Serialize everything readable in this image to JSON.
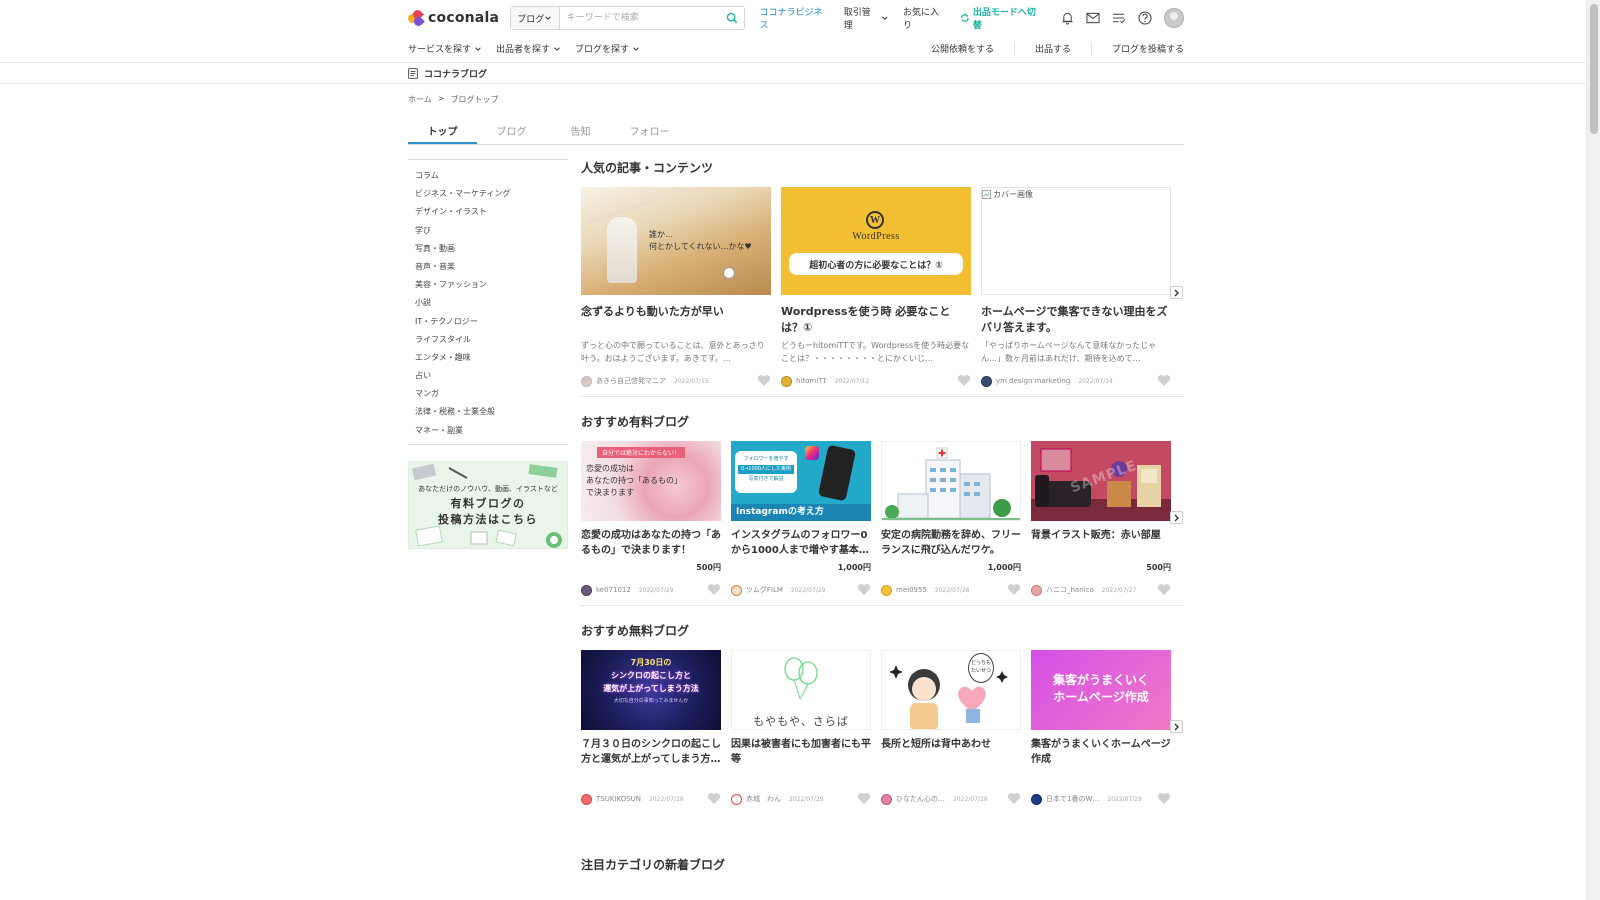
{
  "header": {
    "logo_text": "coconala",
    "search": {
      "category": "ブログ",
      "placeholder": "キーワードで検索"
    },
    "nav": {
      "business": "ココナラビジネス",
      "trade": "取引管理",
      "favorites": "お気に入り",
      "seller_mode": "出品モードへ切替"
    }
  },
  "subnav": {
    "left": [
      "サービスを探す",
      "出品者を探す",
      "ブログを探す"
    ],
    "right": [
      "公開依頼をする",
      "出品する",
      "ブログを投稿する"
    ]
  },
  "band": {
    "title": "ココナラブログ"
  },
  "breadcrumb": [
    "ホーム",
    ">",
    "ブログトップ"
  ],
  "tabs": [
    "トップ",
    "ブログ",
    "告知",
    "フォロー"
  ],
  "sidebar": {
    "categories": [
      "コラム",
      "ビジネス・マーケティング",
      "デザイン・イラスト",
      "学び",
      "写真・動画",
      "音声・音楽",
      "美容・ファッション",
      "小説",
      "IT・テクノロジー",
      "ライフスタイル",
      "エンタメ・趣味",
      "占い",
      "マンガ",
      "法律・税務・士業全般",
      "マネー・副業"
    ],
    "banner_line1": "あなただけのノウハウ、動画、イラストなど",
    "banner_line2": "有料ブログの",
    "banner_line3": "投稿方法はこちら"
  },
  "popular": {
    "title": "人気の記事・コンテンツ",
    "items": [
      {
        "thumb_text1": "誰か…",
        "thumb_text2": "何とかしてくれない…かな♥",
        "title": "念ずるよりも動いた方が早い",
        "desc": "ずっと心の中で願っていることは、意外とあっさり叶う。おはようございます。あきです。…",
        "author": "あきら自己啓発マニア",
        "date": "2022/07/15"
      },
      {
        "thumb_text1": "WordPress",
        "thumb_text2": "超初心者の方に必要なことは？①",
        "title": "Wordpressを使う時 必要なことは？①",
        "desc": "どうもーhitomiTTです。Wordpressを使う時必要なことは？・・・・・・・・とにかくいじ…",
        "author": "hitomiTT",
        "date": "2022/07/12"
      },
      {
        "thumb_text1": "カバー画像",
        "title": "ホームページで集客できない理由をズバリ答えます。",
        "desc": "「やっぱりホームページなんて意味なかったじゃん…」数ヶ月前はあれだけ、期待を込めて…",
        "author": "ym design marketing",
        "date": "2022/07/14"
      }
    ]
  },
  "paid": {
    "title": "おすすめ有料ブログ",
    "items": [
      {
        "thumb_text1": "自分では絶対にわからない！",
        "thumb_text2": "恋愛の成功は",
        "thumb_text3": "あなたの持つ「あるもの」",
        "thumb_text4": "で決まります",
        "title": "恋愛の成功はあなたの持つ「あるもの」で決まります！",
        "price": "500円",
        "author": "ke071012",
        "date": "2022/07/29"
      },
      {
        "thumb_text1": "フォロワーを増やす",
        "thumb_text2": "0→1000人にした実例",
        "thumb_text3": "写真付きで解説",
        "thumb_text4": "Instagramの考え方",
        "title": "インスタグラムのフォロワー0から1000人まで増やす基本…",
        "price": "1,000円",
        "author": "ツムグFILM",
        "date": "2022/07/29"
      },
      {
        "title": "安定の病院勤務を辞め、フリーランスに飛び込んだワケ。",
        "price": "1,000円",
        "author": "mei0955",
        "date": "2022/07/28"
      },
      {
        "thumb_text1": "SAMPLE",
        "title": "背景イラスト販売：赤い部屋",
        "price": "500円",
        "author": "ハニコ_hanico",
        "date": "2022/07/27"
      }
    ]
  },
  "free": {
    "title": "おすすめ無料ブログ",
    "items": [
      {
        "thumb_text1": "7月30日の",
        "thumb_text2": "シンクロの起こし方と",
        "thumb_text3": "運気が上がってしまう方法",
        "thumb_text4": "大切な自分の事知ってみませんか",
        "title": "７月３０日のシンクロの起こし方と運気が上がってしまう方…",
        "author": "TSUKIKOSUN",
        "date": "2022/07/29"
      },
      {
        "thumb_text1": "もやもや、さらば",
        "title": "因果は被害者にも加害者にも平等",
        "author": "赤城　わん",
        "date": "2022/07/29"
      },
      {
        "thumb_text1": "どっちもたいせつ",
        "title": "長所と短所は背中あわせ",
        "author": "ひなたん心の…",
        "date": "2022/07/29"
      },
      {
        "thumb_text1": "集客がうまくいく",
        "thumb_text2": "ホームページ作成",
        "title": "集客がうまくいくホームページ作成",
        "author": "日本で1番のW…",
        "date": "2022/07/29"
      }
    ]
  },
  "next_section": {
    "title": "注目カテゴリの新着ブログ"
  },
  "colors": {
    "accent": "#2f8fd0",
    "seller": "#1db3a6",
    "link": "#1b86c8"
  }
}
